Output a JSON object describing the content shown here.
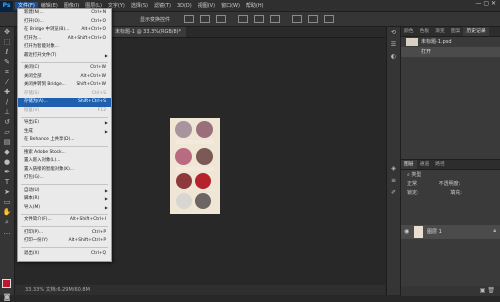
{
  "menubar": {
    "logo": "Ps",
    "items": [
      "文件(F)",
      "编辑(E)",
      "图像(I)",
      "图层(L)",
      "文字(Y)",
      "选择(S)",
      "滤镜(T)",
      "3D(D)",
      "视图(V)",
      "窗口(W)",
      "帮助(H)"
    ],
    "window_controls": "—  ▢  ✕"
  },
  "options_bar": {
    "text": "显示变换控件"
  },
  "doc_tab": {
    "label": "未标题-1 @ 33.3%(RGB/8)*"
  },
  "status_bar": {
    "text": "33.33%    文档:6.29M/60.8M"
  },
  "file_menu": {
    "items": [
      {
        "label": "新建(N)...",
        "shortcut": "Ctrl+N"
      },
      {
        "label": "打开(O)...",
        "shortcut": "Ctrl+O"
      },
      {
        "label": "在 Bridge 中浏览(B)...",
        "shortcut": "Alt+Ctrl+O"
      },
      {
        "label": "打开为...",
        "shortcut": "Alt+Shift+Ctrl+O"
      },
      {
        "label": "打开为智能对象...",
        "shortcut": ""
      },
      {
        "label": "最近打开文件(T)",
        "shortcut": "",
        "submenu": true
      },
      {
        "sep": true
      },
      {
        "label": "关闭(C)",
        "shortcut": "Ctrl+W"
      },
      {
        "label": "关闭全部",
        "shortcut": "Alt+Ctrl+W"
      },
      {
        "label": "关闭并转到 Bridge...",
        "shortcut": "Shift+Ctrl+W"
      },
      {
        "label": "存储(S)",
        "shortcut": "Ctrl+S",
        "disabled": true
      },
      {
        "label": "存储为(A)...",
        "shortcut": "Shift+Ctrl+S",
        "highlight": true
      },
      {
        "label": "恢复(V)",
        "shortcut": "F12",
        "disabled": true
      },
      {
        "sep": true
      },
      {
        "label": "导出(E)",
        "shortcut": "",
        "submenu": true
      },
      {
        "label": "生成",
        "shortcut": "",
        "submenu": true
      },
      {
        "label": "在 Behance 上共享(D)...",
        "shortcut": ""
      },
      {
        "sep": true
      },
      {
        "label": "搜索 Adobe Stock...",
        "shortcut": ""
      },
      {
        "label": "置入嵌入对象(L)...",
        "shortcut": ""
      },
      {
        "label": "置入链接的智能对象(K)...",
        "shortcut": ""
      },
      {
        "label": "打包(G)...",
        "shortcut": ""
      },
      {
        "sep": true
      },
      {
        "label": "自动(U)",
        "shortcut": "",
        "submenu": true
      },
      {
        "label": "脚本(R)",
        "shortcut": "",
        "submenu": true
      },
      {
        "label": "导入(M)",
        "shortcut": "",
        "submenu": true
      },
      {
        "sep": true
      },
      {
        "label": "文件简介(F)...",
        "shortcut": "Alt+Shift+Ctrl+I"
      },
      {
        "sep": true
      },
      {
        "label": "打印(P)...",
        "shortcut": "Ctrl+P"
      },
      {
        "label": "打印一份(Y)",
        "shortcut": "Alt+Shift+Ctrl+P"
      },
      {
        "sep": true
      },
      {
        "label": "退出(X)",
        "shortcut": "Ctrl+Q"
      }
    ]
  },
  "history_panel": {
    "tabs": [
      "颜色",
      "色板",
      "渐变",
      "图案",
      "历史记录"
    ],
    "active_tab": 4,
    "items": [
      "未标题-1.psd",
      "打开"
    ]
  },
  "layers_panel": {
    "tabs": [
      "图层",
      "通道",
      "路径"
    ],
    "filter_label": "类型",
    "blend_mode": "正常",
    "opacity_label": "不透明度:",
    "lock_label": "锁定:",
    "fill_label": "填充:",
    "layer_name": "图层 1"
  }
}
